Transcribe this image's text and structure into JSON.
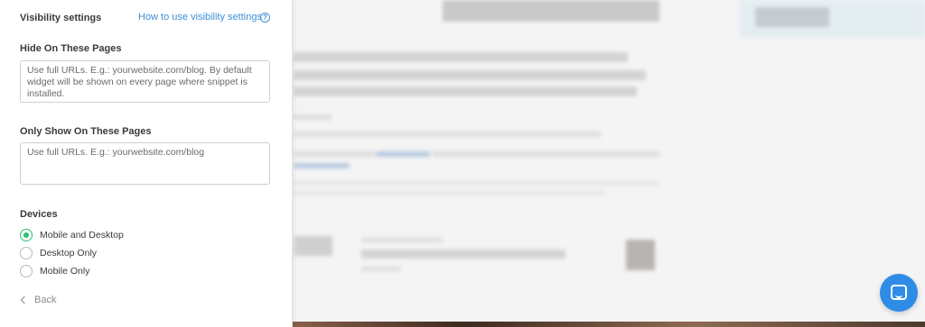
{
  "panel": {
    "title": "Visibility settings",
    "help_link": "How to use visibility settings",
    "help_icon": "question-circle-icon",
    "hide_section": {
      "label": "Hide On These Pages",
      "placeholder": "Use full URLs. E.g.: yourwebsite.com/blog. By default widget will be shown on every page where snippet is installed.",
      "value": ""
    },
    "show_section": {
      "label": "Only Show On These Pages",
      "placeholder": "Use full URLs. E.g.: yourwebsite.com/blog",
      "value": ""
    },
    "devices": {
      "label": "Devices",
      "options": [
        {
          "label": "Mobile and Desktop",
          "selected": true
        },
        {
          "label": "Desktop Only",
          "selected": false
        },
        {
          "label": "Mobile Only",
          "selected": false
        }
      ]
    },
    "back_label": "Back",
    "back_icon": "chevron-left-icon"
  },
  "chat_launcher": {
    "icon": "chat-icon",
    "color": "#2f8ce6"
  },
  "colors": {
    "accent_link": "#3d8fd6",
    "radio_selected": "#2fbf71"
  }
}
